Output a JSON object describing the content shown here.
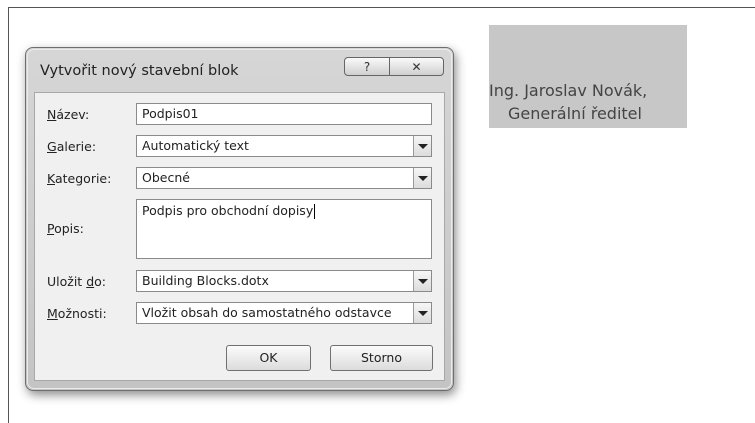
{
  "document": {
    "selected_line1": "Ing. Jaroslav Novák,",
    "selected_line2": "Generální ředitel"
  },
  "dialog": {
    "title": "Vytvořit nový stavební blok",
    "help_button": "?",
    "close_button": "✕",
    "fields": {
      "name_label_u": "N",
      "name_label_rest": "ázev:",
      "name_value": "Podpis01",
      "gallery_label_u": "G",
      "gallery_label_rest": "alerie:",
      "gallery_value": "Automatický text",
      "category_label_u": "K",
      "category_label_rest": "ategorie:",
      "category_value": "Obecné",
      "description_label_u": "P",
      "description_label_rest": "opis:",
      "description_value": "Podpis pro obchodní dopisy",
      "save_label_pre": "Uložit ",
      "save_label_u": "d",
      "save_label_rest": "o:",
      "save_value": "Building Blocks.dotx",
      "options_label_u": "M",
      "options_label_rest": "ožnosti:",
      "options_value": "Vložit obsah do samostatného odstavce"
    },
    "ok_label": "OK",
    "cancel_label": "Storno"
  }
}
